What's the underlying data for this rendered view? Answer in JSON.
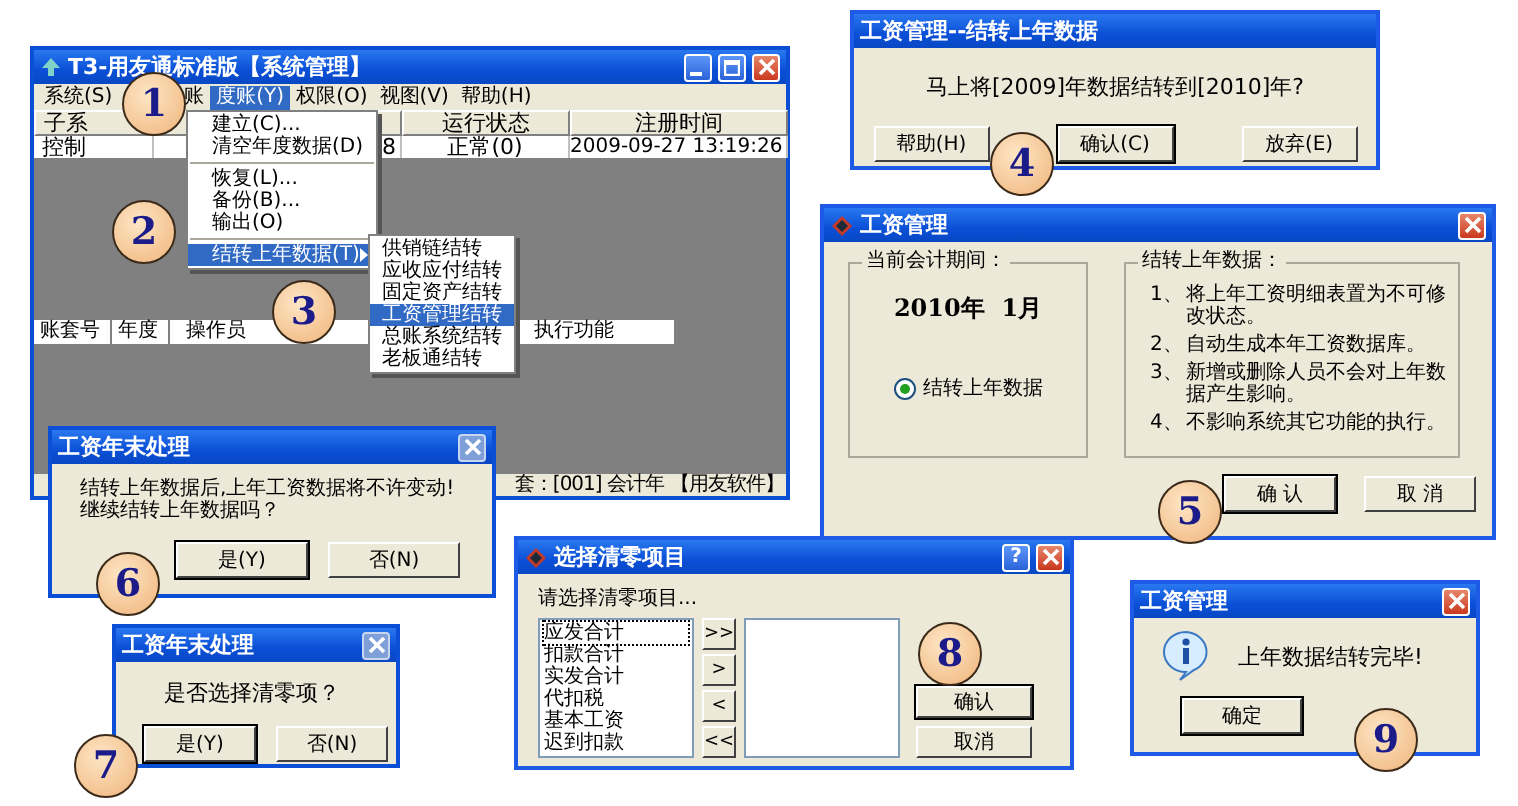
{
  "main_window": {
    "title": "T3-用友通标准版【系统管理】",
    "menu_bar": [
      {
        "label": "系统(S)",
        "selected": false
      },
      {
        "label": "账",
        "selected": false
      },
      {
        "label": "度账(Y)",
        "selected": true
      },
      {
        "label": "权限(O)",
        "selected": false
      },
      {
        "label": "视图(V)",
        "selected": false
      },
      {
        "label": "帮助(H)",
        "selected": false
      }
    ],
    "status_table": {
      "columns": [
        "子系",
        "",
        "运行状态",
        "注册时间"
      ],
      "rows": [
        [
          "控制",
          "8",
          "正常(0)",
          "2009-09-27 13:19:26"
        ]
      ]
    },
    "dropdown_menu": [
      {
        "kind": "item",
        "label": "建立(C)...",
        "selected": false
      },
      {
        "kind": "item",
        "label": "清空年度数据(D)",
        "selected": false
      },
      {
        "kind": "separator"
      },
      {
        "kind": "item",
        "label": "恢复(L)...",
        "selected": false
      },
      {
        "kind": "item",
        "label": "备份(B)...",
        "selected": false
      },
      {
        "kind": "item",
        "label": "输出(O)",
        "selected": false
      },
      {
        "kind": "separator"
      },
      {
        "kind": "submenu",
        "label": "结转上年数据(T)",
        "selected": true
      }
    ],
    "submenu": [
      {
        "label": "供销链结转",
        "selected": false
      },
      {
        "label": "应收应付结转",
        "selected": false
      },
      {
        "label": "固定资产结转",
        "selected": false
      },
      {
        "label": "工资管理结转",
        "selected": true
      },
      {
        "label": "总账系统结转",
        "selected": false
      },
      {
        "label": "老板通结转",
        "selected": false
      }
    ],
    "log_table": {
      "columns": [
        "账套号",
        "年度",
        "操作员",
        "执行功能"
      ]
    },
    "status_bar": [
      "套：[001] 会计年",
      "【用友软件】"
    ]
  },
  "carryover_confirm": {
    "title": "工资管理--结转上年数据",
    "message": "马上将[2009]年数据结转到[2010]年?",
    "buttons": [
      {
        "label": "帮助(H)",
        "default": false
      },
      {
        "label": "确认(C)",
        "default": true
      },
      {
        "label": "放弃(E)",
        "default": false
      }
    ]
  },
  "carryover_options": {
    "title": "工资管理",
    "close_button": {
      "disabled": false
    },
    "period": {
      "legend": "当前会计期间：",
      "value": "2010年  1月",
      "option": {
        "label": "结转上年数据",
        "checked": true
      }
    },
    "notes": {
      "legend": "结转上年数据：",
      "items": [
        {
          "number": "1、",
          "text": "将上年工资明细表置为不可修改状态。"
        },
        {
          "number": "2、",
          "text": "自动生成本年工资数据库。"
        },
        {
          "number": "3、",
          "text": "新增或删除人员不会对上年数据产生影响。"
        },
        {
          "number": "4、",
          "text": "不影响系统其它功能的执行。"
        }
      ]
    },
    "buttons": [
      {
        "label": "确 认",
        "default": true
      },
      {
        "label": "取 消",
        "default": false
      }
    ]
  },
  "year_end_warning": {
    "title": "工资年末处理",
    "close_button": {
      "disabled": true
    },
    "lines": [
      "结转上年数据后,上年工资数据将不许变动!",
      "继续结转上年数据吗？"
    ],
    "buttons": [
      {
        "label": "是(Y)",
        "default": true
      },
      {
        "label": "否(N)",
        "default": false
      }
    ]
  },
  "zero_items_prompt": {
    "title": "工资年末处理",
    "close_button": {
      "disabled": true
    },
    "lines": [
      "是否选择清零项？"
    ],
    "buttons": [
      {
        "label": "是(Y)",
        "default": true
      },
      {
        "label": "否(N)",
        "default": false
      }
    ]
  },
  "zero_items_select": {
    "title": "选择清零项目",
    "help_button": "?",
    "close_button": {
      "disabled": false
    },
    "prompt": "请选择清零项目...",
    "available": [
      {
        "label": "应发合计",
        "focused": true
      },
      {
        "label": "扣款合计",
        "focused": false
      },
      {
        "label": "实发合计",
        "focused": false
      },
      {
        "label": "代扣税",
        "focused": false
      },
      {
        "label": "基本工资",
        "focused": false
      },
      {
        "label": "迟到扣款",
        "focused": false
      }
    ],
    "move_buttons": [
      ">>",
      ">",
      "<",
      "<<"
    ],
    "buttons": [
      {
        "label": "确认",
        "default": true
      },
      {
        "label": "取消",
        "default": false
      }
    ]
  },
  "done_message": {
    "title": "工资管理",
    "close_button": {
      "disabled": false
    },
    "message": "上年数据结转完毕!",
    "buttons": [
      {
        "label": "确定",
        "default": true
      }
    ]
  },
  "steps": [
    {
      "number": "1"
    },
    {
      "number": "2"
    },
    {
      "number": "3"
    },
    {
      "number": "4"
    },
    {
      "number": "5"
    },
    {
      "number": "6"
    },
    {
      "number": "7"
    },
    {
      "number": "8"
    },
    {
      "number": "9"
    }
  ]
}
